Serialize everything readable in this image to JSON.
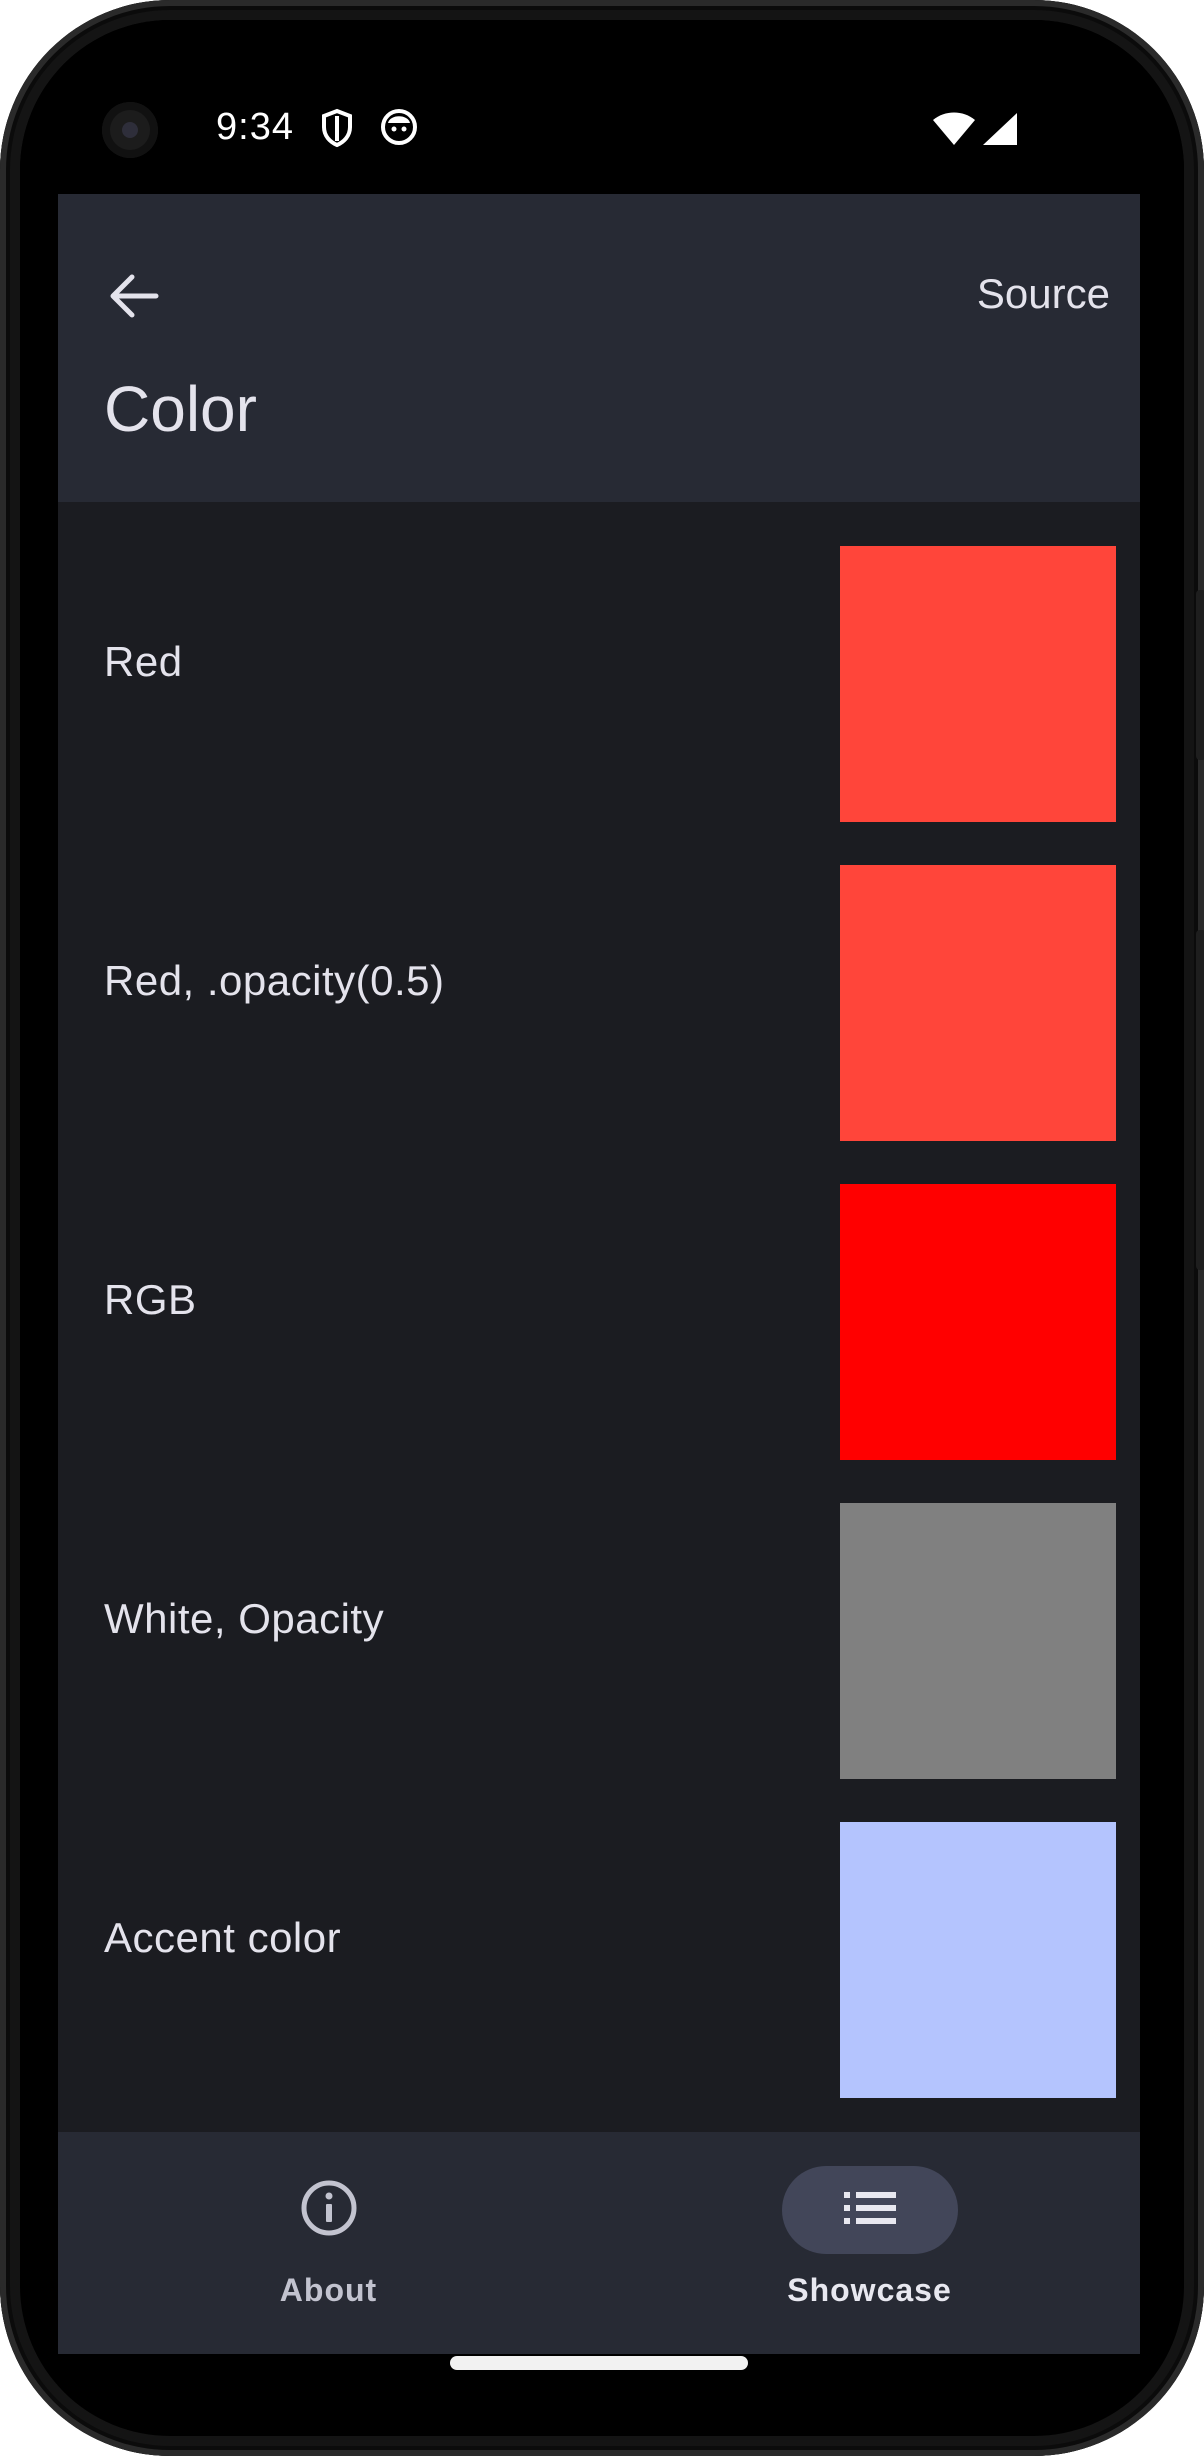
{
  "status_bar": {
    "time": "9:34"
  },
  "app_bar": {
    "back_icon": "arrow-left-icon",
    "title": "Color",
    "source_label": "Source"
  },
  "rows": [
    {
      "label": "Red",
      "color": "#ff453a"
    },
    {
      "label": "Red, .opacity(0.5)",
      "color": "#ff453a"
    },
    {
      "label": "RGB",
      "color": "#ff0000"
    },
    {
      "label": "White, Opacity",
      "color": "#808080"
    },
    {
      "label": "Accent color",
      "color": "#b4c4fe"
    }
  ],
  "bottom_nav": {
    "items": [
      {
        "label": "About",
        "icon": "info-icon",
        "selected": false
      },
      {
        "label": "Showcase",
        "icon": "list-icon",
        "selected": true
      }
    ]
  },
  "colors": {
    "background": "#1b1c21",
    "surface": "#272a34",
    "selected_pill": "#424659",
    "text": "#e4e3ec"
  }
}
